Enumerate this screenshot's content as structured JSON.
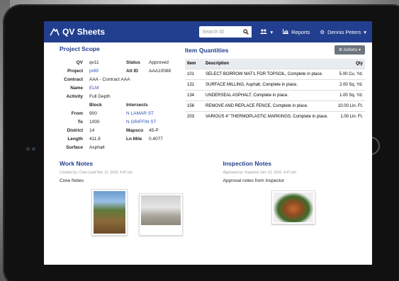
{
  "app": {
    "title": "QV Sheets",
    "search_placeholder": "Search ID",
    "reports_label": "Reports",
    "user_name": "Dennis Peters",
    "brand_color": "#223f8f"
  },
  "project_scope": {
    "title": "Project Scope",
    "qv": "qv11",
    "status": "Approved",
    "project": "pr89",
    "alt_id": "AAA10088",
    "contract": "AAA - Contract AAA",
    "name": "ELM",
    "activity": "Full Depth",
    "block_header": "Block",
    "intersects_header": "Intersects",
    "from_block": "900",
    "from_intersects": "N LAMAR ST",
    "to_block": "1000",
    "to_intersects": "N GRIFFIN ST",
    "district": "14",
    "mapsco": "45-P",
    "length": "411.8",
    "ln_mile": "0.4077",
    "surface": "Asphalt",
    "labels": {
      "qv": "QV",
      "status": "Status",
      "project": "Project",
      "alt_id": "Alt ID",
      "contract": "Contract",
      "name": "Name",
      "activity": "Activity",
      "from": "From",
      "to": "To",
      "district": "District",
      "mapsco": "Mapsco",
      "length": "Length",
      "ln_mile": "Ln Mile",
      "surface": "Surface"
    }
  },
  "item_quantities": {
    "title": "Item Quantities",
    "actions_label": "Actions",
    "columns": [
      "Item",
      "Description",
      "Qty"
    ],
    "rows": [
      {
        "item": "101",
        "description": "SELECT BORROW MAT'L FOR TOPSOIL, Complete in place.",
        "qty": "5.00 Cu. Yd."
      },
      {
        "item": "131",
        "description": "SURFACE MILLING, Asphalt, Complete in place.",
        "qty": "2.00 Sq. Yd."
      },
      {
        "item": "134",
        "description": "UNDERSEAL ASPHALT, Complete in place.",
        "qty": "1.00 Sq. Yd."
      },
      {
        "item": "156",
        "description": "REMOVE AND REPLACE FENCE, Complete in place.",
        "qty": "10.00 Lin. Ft."
      },
      {
        "item": "203",
        "description": "VARIOUS 4\" THERMOPLASTIC MARKINGS, Complete in place.",
        "qty": "1.00 Lin. Ft."
      }
    ]
  },
  "work_notes": {
    "title": "Work Notes",
    "meta": "Created by: Crew Lead    Dec 11, 2016, 4:47 pm",
    "text": "Crew Notes"
  },
  "inspection_notes": {
    "title": "Inspection Notes",
    "meta": "Approved by: Inspector    Dec 12, 2016, 4:47 pm",
    "text": "Approval notes from Inspector"
  }
}
